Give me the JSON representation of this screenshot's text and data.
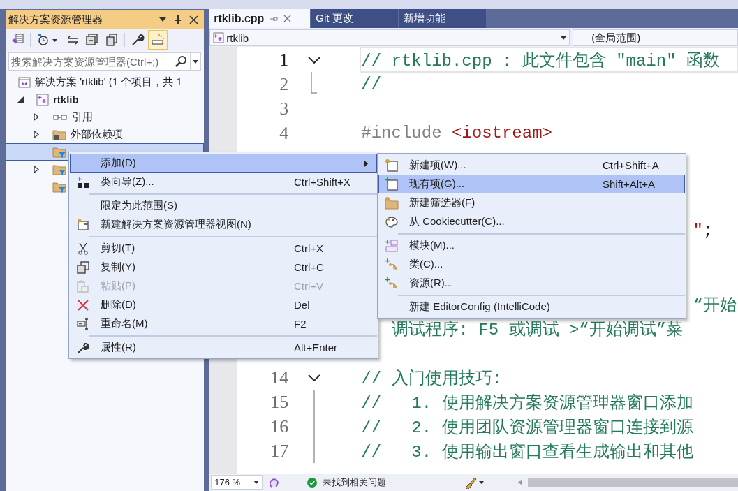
{
  "solution_explorer": {
    "title": "解决方案资源管理器",
    "toolbar": [
      {
        "kind": "vs",
        "selected": false
      },
      {
        "kind": "history",
        "selected": false
      },
      {
        "kind": "sync",
        "selected": false
      },
      {
        "kind": "collapse",
        "selected": false
      },
      {
        "kind": "pages",
        "selected": false
      },
      {
        "kind": "wrench",
        "selected": false
      },
      {
        "kind": "preview",
        "selected": true
      }
    ],
    "search": {
      "placeholder": "搜索解决方案资源管理器(Ctrl+;)"
    },
    "tree": [
      {
        "label": "解决方案 'rtklib' (1 个项目，共 1",
        "kind": "solution",
        "expandable": false,
        "selected": false,
        "children": [
          {
            "label": "rtklib",
            "kind": "project",
            "expandable": true,
            "expanded": true,
            "selected": false,
            "children": [
              {
                "label": "引用",
                "kind": "references",
                "expandable": true,
                "expanded": false,
                "selected": false
              },
              {
                "label": "外部依赖项",
                "kind": "external",
                "expandable": true,
                "expanded": false,
                "selected": false
              },
              {
                "kind": "filter",
                "expandable": false,
                "selected": true
              },
              {
                "kind": "filter",
                "expandable": true,
                "expanded": false,
                "selected": false
              },
              {
                "kind": "filter",
                "expandable": false,
                "selected": false
              }
            ]
          }
        ]
      }
    ]
  },
  "editor": {
    "tabs": [
      {
        "label": "rtklib.cpp",
        "selected": true
      },
      {
        "label": "Git 更改",
        "selected": false
      },
      {
        "label": "新增功能",
        "selected": false
      }
    ],
    "nav": {
      "project": "rtklib",
      "scope": "(全局范围)"
    },
    "lines": [
      {
        "number": "1",
        "fold_start": true,
        "fold_end": false,
        "in_fold": false,
        "current": true,
        "parts": [
          {
            "text": "// rtklib.cpp : 此文件包含 \"main\" 函数",
            "kind": "comment"
          }
        ]
      },
      {
        "number": "2",
        "fold_start": false,
        "fold_end": true,
        "in_fold": false,
        "current": false,
        "parts": [
          {
            "text": "//",
            "kind": "comment"
          }
        ]
      },
      {
        "number": "3",
        "fold_start": false,
        "fold_end": false,
        "in_fold": false,
        "current": false
      },
      {
        "number": "4",
        "fold_start": false,
        "fold_end": false,
        "in_fold": false,
        "current": false,
        "parts": [
          {
            "text": "#include ",
            "kind": "preprocessor"
          },
          {
            "text": "<iostream>",
            "kind": "string"
          }
        ]
      },
      {
        "current": false
      },
      {
        "current": false
      },
      {
        "current": false
      },
      {
        "current": false,
        "parts": [
          {
            "text": "                                 \"",
            "kind": "string"
          },
          {
            "text": ";",
            "kind": "plain"
          }
        ]
      },
      {
        "current": false
      },
      {
        "current": false
      },
      {
        "current": false,
        "parts": [
          {
            "text": "                                 “开始",
            "kind": "comment"
          }
        ]
      },
      {
        "current": false,
        "parts": [
          {
            "text": "   调试程序: F5 或调试 >“开始调试”菜",
            "kind": "comment"
          }
        ]
      },
      {
        "current": false
      },
      {
        "number": "14",
        "fold_start": true,
        "fold_end": false,
        "in_fold": false,
        "current": false,
        "parts": [
          {
            "text": "// 入门使用技巧:",
            "kind": "comment"
          }
        ]
      },
      {
        "number": "15",
        "fold_start": false,
        "fold_end": false,
        "in_fold": true,
        "current": false,
        "parts": [
          {
            "text": "//   1. 使用解决方案资源管理器窗口添加",
            "kind": "comment"
          }
        ]
      },
      {
        "number": "16",
        "fold_start": false,
        "fold_end": false,
        "in_fold": true,
        "current": false,
        "parts": [
          {
            "text": "//   2. 使用团队资源管理器窗口连接到源",
            "kind": "comment"
          }
        ]
      },
      {
        "number": "17",
        "fold_start": false,
        "fold_end": false,
        "in_fold": true,
        "current": false,
        "parts": [
          {
            "text": "//   3. 使用输出窗口查看生成输出和其他",
            "kind": "comment"
          }
        ]
      }
    ],
    "status": {
      "zoom": "176 %",
      "issues": "未找到相关问题"
    }
  },
  "context_menu": {
    "items": [
      {
        "kind": "item",
        "label": "添加(D)",
        "submenu": true,
        "selected": true,
        "disabled": false
      },
      {
        "kind": "item",
        "label": "类向导(Z)...",
        "shortcut": "Ctrl+Shift+X",
        "submenu": false,
        "selected": false,
        "disabled": false
      },
      {
        "kind": "separator"
      },
      {
        "kind": "item",
        "label": "限定为此范围(S)",
        "submenu": false,
        "selected": false,
        "disabled": false
      },
      {
        "kind": "item",
        "label": "新建解决方案资源管理器视图(N)",
        "submenu": false,
        "selected": false,
        "disabled": false
      },
      {
        "kind": "separator"
      },
      {
        "kind": "item",
        "label": "剪切(T)",
        "shortcut": "Ctrl+X",
        "submenu": false,
        "selected": false,
        "disabled": false
      },
      {
        "kind": "item",
        "label": "复制(Y)",
        "shortcut": "Ctrl+C",
        "submenu": false,
        "selected": false,
        "disabled": false
      },
      {
        "kind": "item",
        "label": "粘贴(P)",
        "shortcut": "Ctrl+V",
        "submenu": false,
        "selected": false,
        "disabled": true
      },
      {
        "kind": "item",
        "label": "删除(D)",
        "shortcut": "Del",
        "submenu": false,
        "selected": false,
        "disabled": false
      },
      {
        "kind": "item",
        "label": "重命名(M)",
        "shortcut": "F2",
        "submenu": false,
        "selected": false,
        "disabled": false
      },
      {
        "kind": "separator"
      },
      {
        "kind": "item",
        "label": "属性(R)",
        "shortcut": "Alt+Enter",
        "submenu": false,
        "selected": false,
        "disabled": false
      }
    ]
  },
  "submenu": {
    "items": [
      {
        "kind": "item",
        "label": "新建项(W)...",
        "shortcut": "Ctrl+Shift+A",
        "selected": false
      },
      {
        "kind": "item",
        "label": "现有项(G)...",
        "shortcut": "Shift+Alt+A",
        "selected": true
      },
      {
        "kind": "item",
        "label": "新建筛选器(F)",
        "selected": false
      },
      {
        "kind": "item",
        "label": "从 Cookiecutter(C)...",
        "selected": false
      },
      {
        "kind": "separator"
      },
      {
        "kind": "item",
        "label": "模块(M)...",
        "selected": false
      },
      {
        "kind": "item",
        "label": "类(C)...",
        "selected": false
      },
      {
        "kind": "item",
        "label": "资源(R)...",
        "selected": false
      },
      {
        "kind": "separator"
      },
      {
        "kind": "item",
        "label": "新建 EditorConfig (IntelliCode)",
        "selected": false
      }
    ]
  }
}
